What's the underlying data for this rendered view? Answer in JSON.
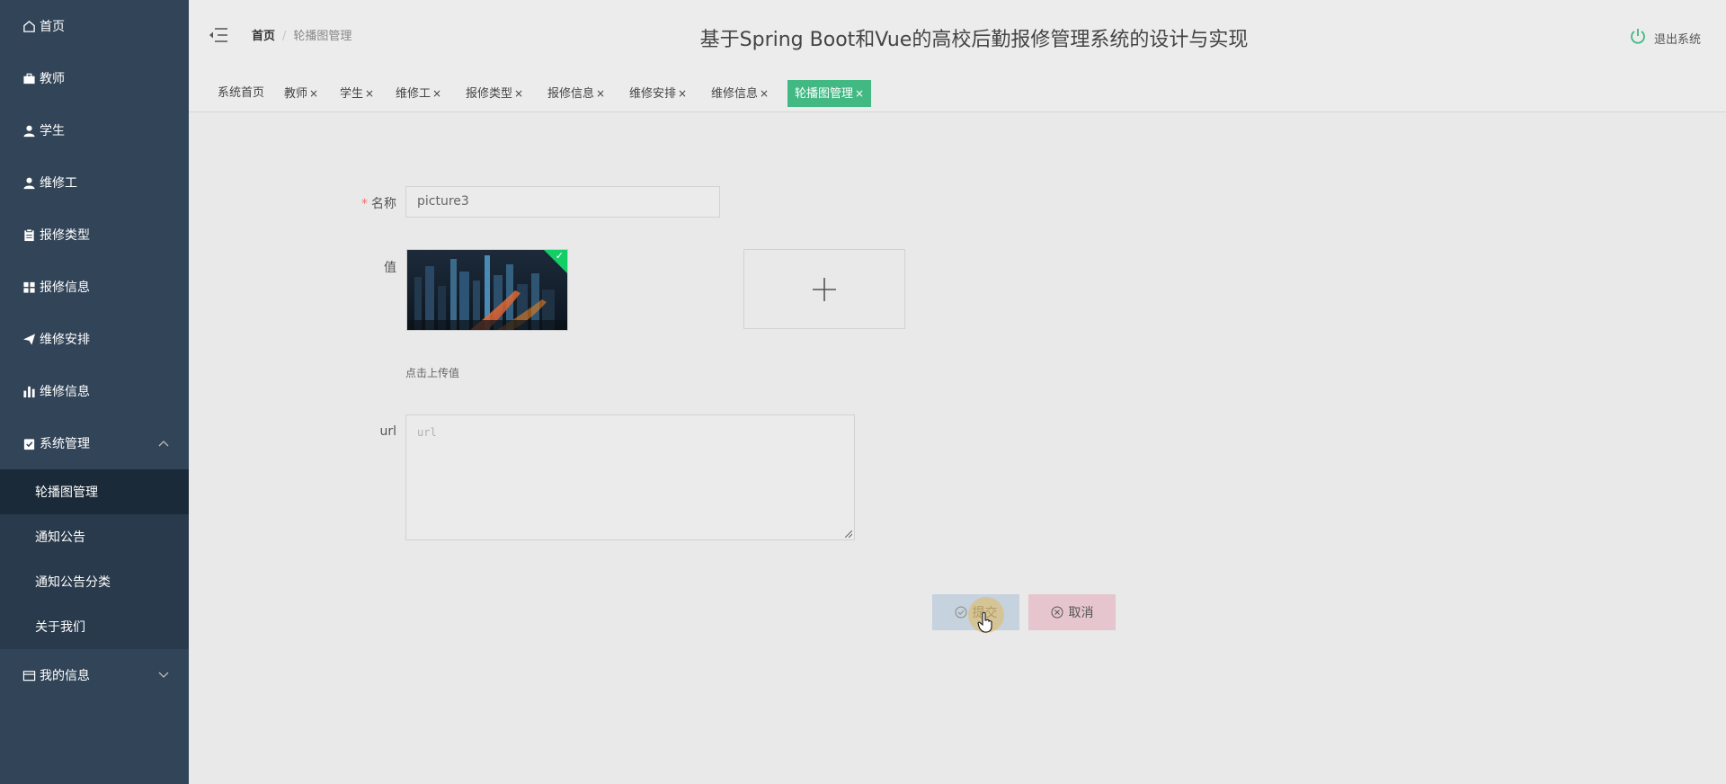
{
  "sidebar": {
    "items": [
      {
        "label": "首页",
        "icon": "home-icon"
      },
      {
        "label": "教师",
        "icon": "briefcase-icon"
      },
      {
        "label": "学生",
        "icon": "user-icon"
      },
      {
        "label": "维修工",
        "icon": "user-icon"
      },
      {
        "label": "报修类型",
        "icon": "clipboard-icon"
      },
      {
        "label": "报修信息",
        "icon": "grid-icon"
      },
      {
        "label": "维修安排",
        "icon": "send-icon"
      },
      {
        "label": "维修信息",
        "icon": "bar-chart-icon"
      },
      {
        "label": "系统管理",
        "icon": "checklist-icon"
      }
    ],
    "submenu": [
      "轮播图管理",
      "通知公告",
      "通知公告分类",
      "关于我们"
    ],
    "profile": {
      "label": "我的信息",
      "icon": "card-icon"
    }
  },
  "header": {
    "breadcrumb_home": "首页",
    "breadcrumb_sep": "/",
    "breadcrumb_current": "轮播图管理",
    "title": "基于Spring Boot和Vue的高校后勤报修管理系统的设计与实现",
    "logout": "退出系统"
  },
  "tabs": [
    "系统首页",
    "教师",
    "学生",
    "维修工",
    "报修类型",
    "报修信息",
    "维修安排",
    "维修信息",
    "轮播图管理"
  ],
  "tab_close": "×",
  "form": {
    "name_label": "名称",
    "name_required": "*",
    "name_value": "picture3",
    "value_label": "值",
    "upload_tip": "点击上传值",
    "url_label": "url",
    "url_placeholder": "url",
    "submit": "提交",
    "cancel": "取消"
  },
  "colors": {
    "sidebar": "#324458",
    "active_tab": "#42b983",
    "submit_bg": "#c6d2de",
    "cancel_bg": "#e6c5cf"
  }
}
